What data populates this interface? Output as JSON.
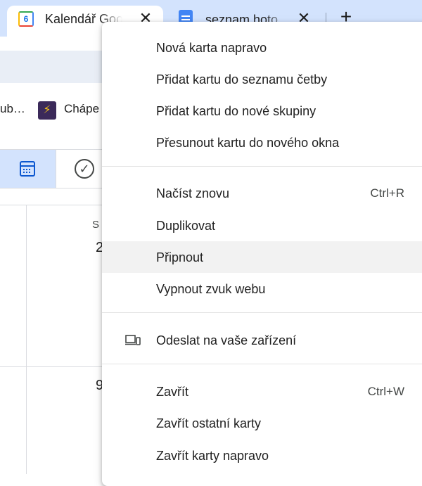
{
  "tabs": [
    {
      "title": "Kalendář Goo",
      "icon": "google-calendar-favicon",
      "icon_text": "6",
      "active": true
    },
    {
      "title": "seznam hoto",
      "icon": "google-docs-favicon",
      "active": false
    }
  ],
  "tab_close_glyph": "✕",
  "new_tab_glyph": "+",
  "bookmarks": [
    {
      "label": "ub…",
      "icon": null
    },
    {
      "label": "Chápe",
      "icon": "bookmark-favicon"
    }
  ],
  "calendar": {
    "day_label": "S",
    "day_num_1": "2",
    "day_num_2": "9",
    "check_glyph": "✓"
  },
  "context_menu": {
    "groups": [
      [
        {
          "label": "Nová karta napravo"
        },
        {
          "label": "Přidat kartu do seznamu četby"
        },
        {
          "label": "Přidat kartu do nové skupiny"
        },
        {
          "label": "Přesunout kartu do nového okna"
        }
      ],
      [
        {
          "label": "Načíst znovu",
          "shortcut": "Ctrl+R"
        },
        {
          "label": "Duplikovat"
        },
        {
          "label": "Připnout",
          "highlighted": true
        },
        {
          "label": "Vypnout zvuk webu"
        }
      ],
      [
        {
          "label": "Odeslat na vaše zařízení",
          "icon": "send-to-devices-icon"
        }
      ],
      [
        {
          "label": "Zavřít",
          "shortcut": "Ctrl+W"
        },
        {
          "label": "Zavřít ostatní karty"
        },
        {
          "label": "Zavřít karty napravo"
        }
      ]
    ]
  },
  "colors": {
    "tabstrip_bg": "#d3e3fd",
    "menu_hover": "#f2f2f2",
    "accent": "#0b57d0"
  }
}
